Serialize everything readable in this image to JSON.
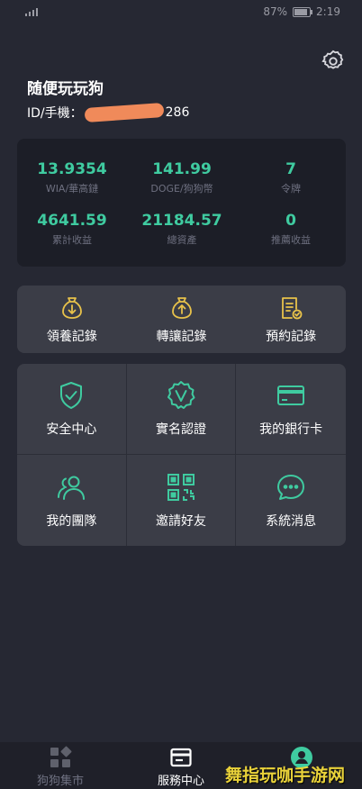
{
  "status_bar": {
    "battery": "87%",
    "battery_level": 0.87,
    "time": "2:19"
  },
  "user": {
    "name": "随便玩玩狗",
    "id_prefix": "ID/手機：",
    "id_suffix": "286"
  },
  "stats": [
    {
      "value": "13.9354",
      "label": "WIA/華高鏈"
    },
    {
      "value": "141.99",
      "label": "DOGE/狗狗幣"
    },
    {
      "value": "7",
      "label": "令牌"
    },
    {
      "value": "4641.59",
      "label": "累計收益"
    },
    {
      "value": "21184.57",
      "label": "總資產"
    },
    {
      "value": "0",
      "label": "推薦收益"
    }
  ],
  "records": [
    {
      "label": "領養記錄",
      "icon": "bag-down-icon"
    },
    {
      "label": "轉讓記錄",
      "icon": "bag-up-icon"
    },
    {
      "label": "預約記錄",
      "icon": "document-check-icon"
    }
  ],
  "services": [
    {
      "label": "安全中心",
      "icon": "shield-check-icon"
    },
    {
      "label": "實名認證",
      "icon": "verified-badge-icon"
    },
    {
      "label": "我的銀行卡",
      "icon": "bank-card-icon"
    },
    {
      "label": "我的團隊",
      "icon": "team-icon"
    },
    {
      "label": "邀請好友",
      "icon": "qr-code-icon"
    },
    {
      "label": "系統消息",
      "icon": "chat-bubble-icon"
    }
  ],
  "bottom_nav": [
    {
      "label": "狗狗集市",
      "icon": "grid-icon",
      "active": false
    },
    {
      "label": "服務中心",
      "icon": "service-card-icon",
      "active": true
    },
    {
      "label": "",
      "icon": "profile-icon",
      "active": false
    }
  ],
  "watermark": "舞指玩咖手游网",
  "colors": {
    "accent": "#3fcba0",
    "gold": "#e8c24a",
    "background": "#262833",
    "card": "#3b3d47"
  }
}
